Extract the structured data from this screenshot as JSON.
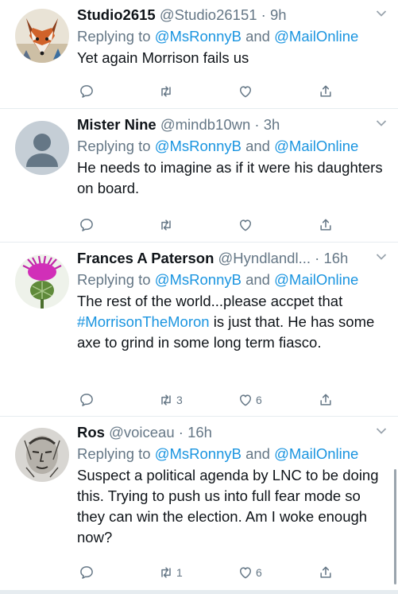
{
  "tweets": [
    {
      "name": "Studio2615",
      "handle": "@Studio26151",
      "sep": "·",
      "time": "9h",
      "replying_prefix": "Replying to ",
      "mention1": "@MsRonnyB",
      "and_word": " and ",
      "mention2": "@MailOnline",
      "text": "Yet again Morrison fails us",
      "retweets": "",
      "likes": "",
      "avatar": "fox-avatar"
    },
    {
      "name": "Mister Nine",
      "handle": "@mindb10wn",
      "sep": "·",
      "time": "3h",
      "replying_prefix": "Replying to ",
      "mention1": "@MsRonnyB",
      "and_word": " and ",
      "mention2": "@MailOnline",
      "text": "He needs to imagine as if it were his daughters on board.",
      "retweets": "",
      "likes": "",
      "avatar": "default-avatar"
    },
    {
      "name": "Frances A Paterson",
      "handle": "@Hyndlandl...",
      "sep": "·",
      "time": "16h",
      "replying_prefix": "Replying to ",
      "mention1": "@MsRonnyB",
      "and_word": " and ",
      "mention2": "@MailOnline",
      "text_before": "The rest of the world...please accpet that ",
      "hashtag": "#MorrisonTheMoron",
      "text_after": " is just that. He has some axe to grind in some long term fiasco.",
      "retweets": "3",
      "likes": "6",
      "avatar": "thistle-avatar"
    },
    {
      "name": "Ros",
      "handle": "@voiceau",
      "sep": "·",
      "time": "16h",
      "replying_prefix": "Replying to ",
      "mention1": "@MsRonnyB",
      "and_word": " and ",
      "mention2": "@MailOnline",
      "text": "Suspect a political agenda by LNC to be doing this. Trying to push us into full fear mode so they can win the election. Am I woke enough now?",
      "retweets": "1",
      "likes": "6",
      "avatar": "sketch-avatar"
    }
  ],
  "colors": {
    "link": "#1b95e0",
    "muted": "#657786",
    "text": "#0f1419",
    "divider": "#e6ecf0"
  },
  "icons": [
    "reply-icon",
    "retweet-icon",
    "like-icon",
    "share-icon",
    "chevron-down-icon"
  ]
}
